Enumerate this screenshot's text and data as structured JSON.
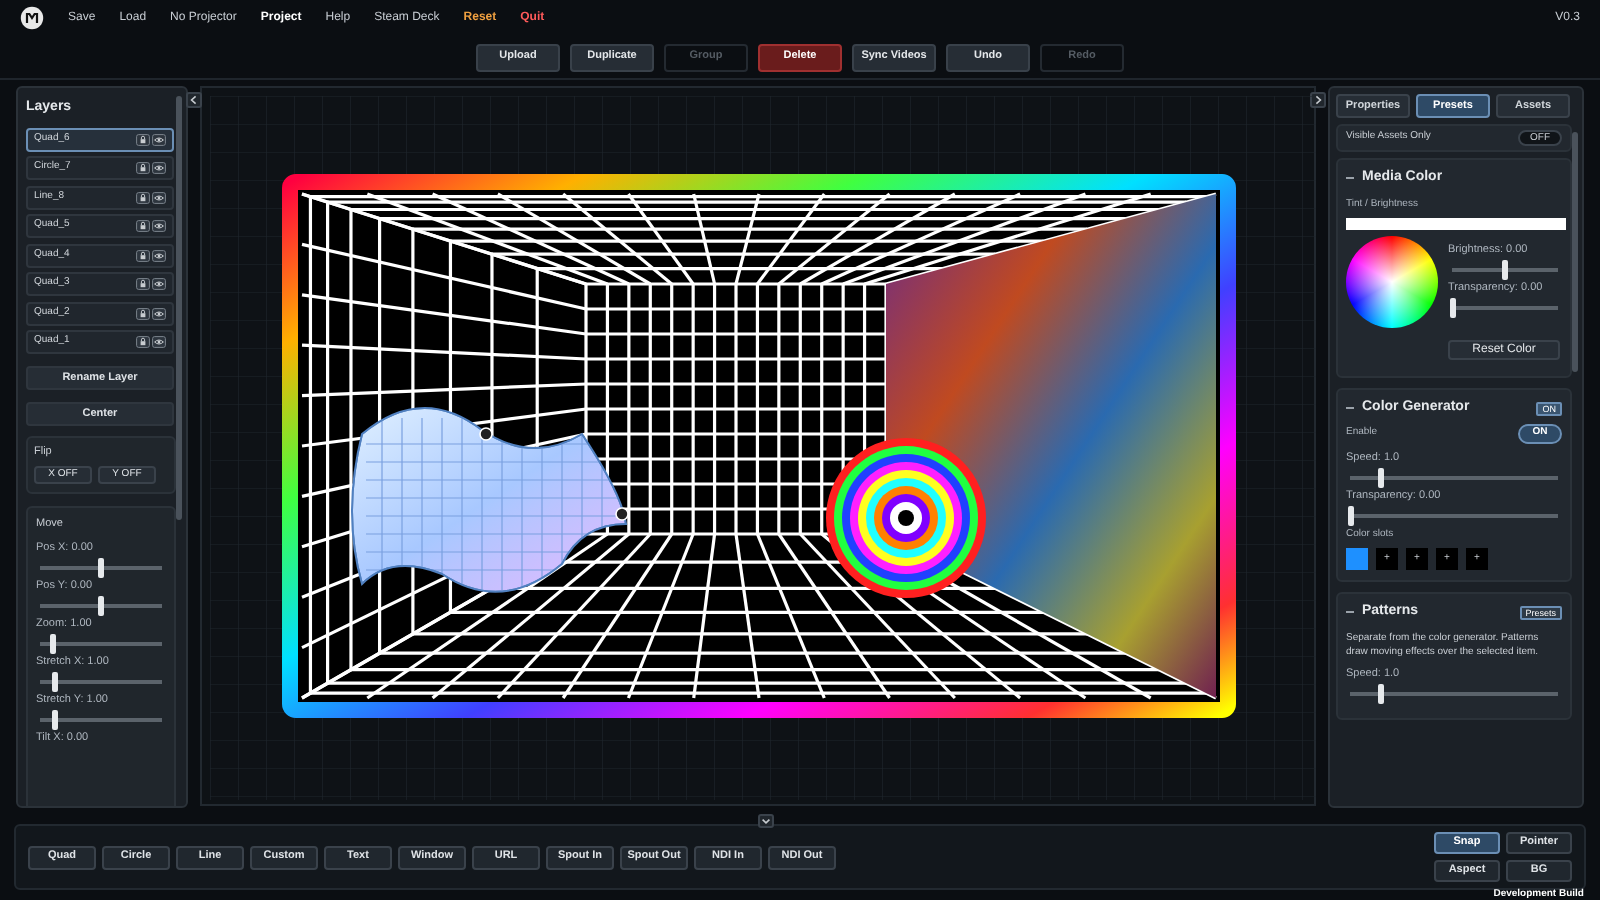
{
  "menu": {
    "items": [
      {
        "label": "Save",
        "kind": "normal"
      },
      {
        "label": "Load",
        "kind": "normal"
      },
      {
        "label": "No Projector",
        "kind": "normal"
      },
      {
        "label": "Project",
        "kind": "active"
      },
      {
        "label": "Help",
        "kind": "normal"
      },
      {
        "label": "Steam Deck",
        "kind": "normal"
      },
      {
        "label": "Reset",
        "kind": "warning"
      },
      {
        "label": "Quit",
        "kind": "danger"
      }
    ],
    "version": "V0.3"
  },
  "toolbar": [
    {
      "label": "Upload",
      "kind": "normal",
      "disabled": false
    },
    {
      "label": "Duplicate",
      "kind": "normal",
      "disabled": false
    },
    {
      "label": "Group",
      "kind": "normal",
      "disabled": true
    },
    {
      "label": "Delete",
      "kind": "danger",
      "disabled": false
    },
    {
      "label": "Sync Videos",
      "kind": "normal",
      "disabled": false
    },
    {
      "label": "Undo",
      "kind": "normal",
      "disabled": false
    },
    {
      "label": "Redo",
      "kind": "normal",
      "disabled": true
    }
  ],
  "layers": {
    "title": "Layers",
    "items": [
      {
        "name": "Quad_6",
        "selected": true
      },
      {
        "name": "Circle_7",
        "selected": false
      },
      {
        "name": "Line_8",
        "selected": false
      },
      {
        "name": "Quad_5",
        "selected": false
      },
      {
        "name": "Quad_4",
        "selected": false
      },
      {
        "name": "Quad_3",
        "selected": false
      },
      {
        "name": "Quad_2",
        "selected": false
      },
      {
        "name": "Quad_1",
        "selected": false
      }
    ],
    "buttons": [
      "Rename Layer",
      "Center"
    ],
    "flip": {
      "title": "Flip",
      "buttons": [
        "X OFF",
        "Y OFF"
      ]
    },
    "move": {
      "title": "Move",
      "sliders": [
        {
          "label": "Pos X: 0.00",
          "level": 0.5
        },
        {
          "label": "Pos Y: 0.00",
          "level": 0.5
        },
        {
          "label": "Zoom: 1.00",
          "level": 0.1
        },
        {
          "label": "Stretch X: 1.00",
          "level": 0.12
        },
        {
          "label": "Stretch Y: 1.00",
          "level": 0.12
        }
      ],
      "cut_label": "Tilt X: 0.00"
    }
  },
  "right_panel": {
    "tabs": [
      {
        "label": "Properties",
        "selected": false
      },
      {
        "label": "Presets",
        "selected": true
      },
      {
        "label": "Assets",
        "selected": false
      }
    ],
    "visible_assets": {
      "label": "Visible Assets Only",
      "toggle": "OFF"
    },
    "media_color": {
      "title": "Media Color",
      "tint_label": "Tint / Brightness",
      "sliders": [
        {
          "label": "Brightness: 0.00",
          "level": 0.5
        },
        {
          "label": "Transparency: 0.00",
          "level": 0
        }
      ],
      "button": "Reset Color"
    },
    "color_generator": {
      "title": "Color Generator",
      "badge": "ON",
      "enable_label": "Enable",
      "enable_toggle": "ON",
      "sliders": [
        {
          "label": "Speed: 1.0",
          "level": 0.15
        },
        {
          "label": "Transparency: 0.00",
          "level": 0
        }
      ],
      "slots_label": "Color slots",
      "slots": [
        {
          "kind": "color",
          "color": "#1e90ff"
        },
        {
          "kind": "empty",
          "label": "+"
        },
        {
          "kind": "empty",
          "label": "+"
        },
        {
          "kind": "empty",
          "label": "+"
        },
        {
          "kind": "empty",
          "label": "+"
        }
      ]
    },
    "patterns": {
      "title": "Patterns",
      "badge": "Presets",
      "description": "Separate from the color generator. Patterns draw moving effects over the selected item.",
      "sliders": [
        {
          "label": "Speed: 1.0",
          "level": 0.15
        }
      ]
    }
  },
  "bottom": {
    "shapes": [
      "Quad",
      "Circle",
      "Line",
      "Custom",
      "Text",
      "Window",
      "URL",
      "Spout In",
      "Spout Out",
      "NDI In",
      "NDI Out"
    ],
    "modes": [
      {
        "label": "Snap",
        "selected": true
      },
      {
        "label": "Pointer",
        "selected": false
      },
      {
        "label": "Aspect",
        "selected": false
      },
      {
        "label": "BG",
        "selected": false
      }
    ],
    "build": "Development Build"
  }
}
